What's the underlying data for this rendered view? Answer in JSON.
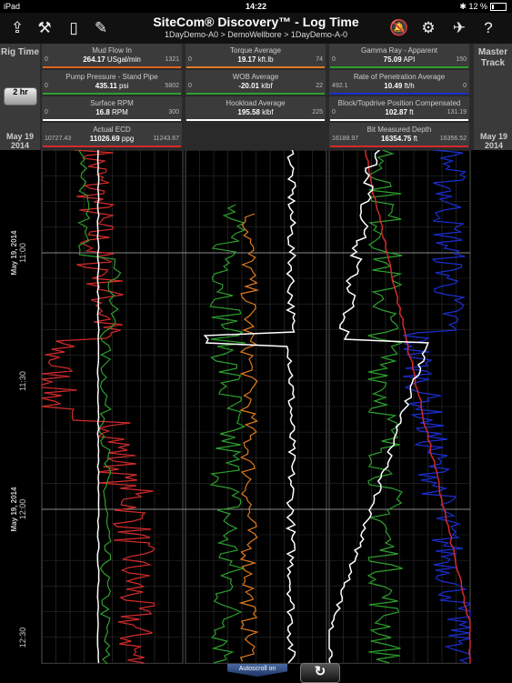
{
  "status": {
    "device": "iPad",
    "time": "14:22",
    "battery": "12 %"
  },
  "app": {
    "title": "SiteCom® Discovery™ - Log Time",
    "breadcrumb": "1DayDemo-A0 > DemoWellbore > 1DayDemo-A-0"
  },
  "left_panel": {
    "label": "Rig Time",
    "hours_button": "2 hr",
    "date_top": "May 19 2014"
  },
  "right_panel": {
    "label": "Master Track",
    "date_top": "May 19 2014"
  },
  "curves": [
    {
      "name": "Mud Flow In",
      "min": "0",
      "value": "264.17",
      "unit": "USgal/min",
      "max": "1321",
      "color": "#e0621f"
    },
    {
      "name": "Torque Average",
      "min": "0",
      "value": "19.17",
      "unit": "kft.lb",
      "max": "74",
      "color": "#e07a20"
    },
    {
      "name": "Gamma Ray - Apparent",
      "min": "0",
      "value": "75.09",
      "unit": "API",
      "max": "150",
      "color": "#2da02d"
    },
    {
      "name": "Pump Pressure - Stand Pipe",
      "min": "0",
      "value": "435.11",
      "unit": "psi",
      "max": "5802",
      "color": "#2da02d"
    },
    {
      "name": "WOB Average",
      "min": "0",
      "value": "-20.01",
      "unit": "klbf",
      "max": "22",
      "color": "#2da02d"
    },
    {
      "name": "Rate of Penetration Average",
      "min": "492.1",
      "value": "10.49",
      "unit": "ft/h",
      "max": "0",
      "color": "#1a2fd0"
    },
    {
      "name": "Surface RPM",
      "min": "0",
      "value": "16.8",
      "unit": "RPM",
      "max": "300",
      "color": "#ffffff"
    },
    {
      "name": "Hookload Average",
      "min": "",
      "value": "195.58",
      "unit": "klbf",
      "max": "225",
      "color": "#ffffff"
    },
    {
      "name": "Block/Topdrive Position Compensated",
      "min": "0",
      "value": "102.87",
      "unit": "ft",
      "max": "131.19",
      "color": "#ffffff"
    },
    {
      "name": "Actual ECD",
      "min": "10727.43",
      "value": "11026.69",
      "unit": "ppg",
      "max": "11243.67",
      "color": "#d42a2a"
    },
    {
      "name": "Bit Measured Depth",
      "min": "16188.97",
      "value": "16354.75",
      "unit": "ft",
      "max": "16356.52",
      "color": "#d42a2a"
    }
  ],
  "time_axis": {
    "labels": [
      {
        "time": "11:00",
        "date": "May 19, 2014"
      },
      {
        "time": "11:30",
        "date": ""
      },
      {
        "time": "12:00",
        "date": "May 19, 2014"
      },
      {
        "time": "12:30",
        "date": ""
      }
    ]
  },
  "controls": {
    "autoscroll": "Autoscroll on",
    "refresh_icon": "refresh-icon"
  },
  "toolbar_icons": [
    "share-icon",
    "rig-icon",
    "book-icon",
    "edit-icon",
    "bell-off-icon",
    "gear-icon",
    "satellite-off-icon",
    "help-icon"
  ]
}
